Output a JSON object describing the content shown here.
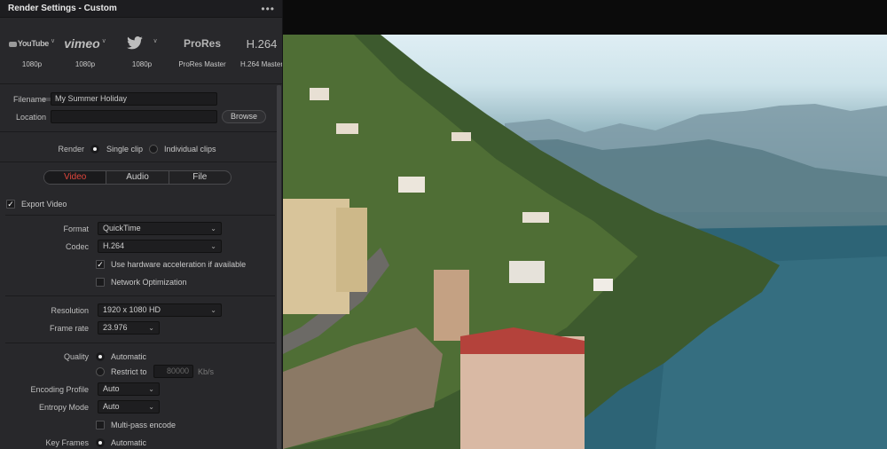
{
  "window": {
    "title": "Render Settings - Custom",
    "menu_icon": "more-horizontal-icon"
  },
  "presets": [
    {
      "logo": "YouTube",
      "sub": "1080p"
    },
    {
      "logo": "vimeo",
      "sub": "1080p"
    },
    {
      "logo": "twitter-bird-icon",
      "sub": "1080p"
    },
    {
      "logo": "ProRes",
      "sub": "ProRes Master"
    },
    {
      "logo": "H.264",
      "sub": "H.264 Master"
    }
  ],
  "file": {
    "filename_label": "Filename",
    "filename_value": "My Summer Holiday",
    "location_label": "Location",
    "location_value": "",
    "browse_label": "Browse"
  },
  "render": {
    "label": "Render",
    "single": "Single clip",
    "individual": "Individual clips",
    "selected": "single"
  },
  "tabs": [
    {
      "label": "Video",
      "active": true
    },
    {
      "label": "Audio",
      "active": false
    },
    {
      "label": "File",
      "active": false
    }
  ],
  "video": {
    "export_label": "Export Video",
    "export_checked": true,
    "format_label": "Format",
    "format_value": "QuickTime",
    "codec_label": "Codec",
    "codec_value": "H.264",
    "hw_accel_label": "Use hardware acceleration if available",
    "hw_accel_checked": true,
    "network_opt_label": "Network Optimization",
    "network_opt_checked": false,
    "resolution_label": "Resolution",
    "resolution_value": "1920 x 1080 HD",
    "framerate_label": "Frame rate",
    "framerate_value": "23.976",
    "quality_label": "Quality",
    "quality_auto": "Automatic",
    "quality_restrict": "Restrict to",
    "restrict_value": "80000",
    "restrict_unit": "Kb/s",
    "encoding_profile_label": "Encoding Profile",
    "encoding_profile_value": "Auto",
    "entropy_label": "Entropy Mode",
    "entropy_value": "Auto",
    "multipass_label": "Multi-pass encode",
    "multipass_checked": false,
    "keyframes_label": "Key Frames",
    "keyframes_value": "Automatic"
  },
  "colors": {
    "accent": "#e0463c",
    "panel": "#28282b",
    "titlebar": "#1d1d20"
  }
}
